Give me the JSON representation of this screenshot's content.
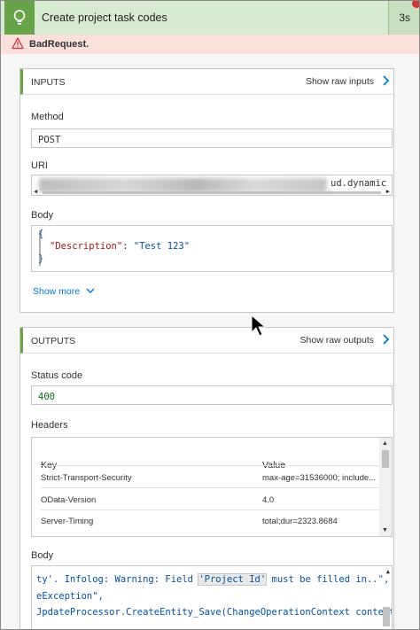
{
  "header": {
    "title": "Create project task codes",
    "duration": "3s"
  },
  "error": {
    "text": "BadRequest."
  },
  "inputs": {
    "title": "INPUTS",
    "raw_link": "Show raw inputs",
    "method_label": "Method",
    "method_value": "POST",
    "uri_label": "URI",
    "uri_value_visible": "ud.dynamic",
    "body_label": "Body",
    "body_lines": [
      "{",
      "\"Description\": \"Test 123\"",
      "}"
    ],
    "body_key": "\"Description\"",
    "body_val": "\"Test 123\"",
    "show_more": "Show more"
  },
  "outputs": {
    "title": "OUTPUTS",
    "raw_link": "Show raw outputs",
    "status_label": "Status code",
    "status_value": "400",
    "headers_label": "Headers",
    "headers_cols": [
      "Key",
      "Value"
    ],
    "headers_rows": [
      {
        "key": "Strict-Transport-Security",
        "value": "max-age=31536000; include..."
      },
      {
        "key": "OData-Version",
        "value": "4.0"
      },
      {
        "key": "Server-Timing",
        "value": "total;dur=2323.8684"
      }
    ],
    "body_label": "Body",
    "body_line1_a": "ty'. Infolog: Warning: Field ",
    "body_line1_b": "'Project Id'",
    "body_line1_c": " must be filled in..\",",
    "body_line2": "eException\",",
    "body_line3": "JpdateProcessor.CreateEntity_Save(ChangeOperationContext context, C"
  },
  "colors": {
    "accent": "#68a34a",
    "error_bg": "#fbe0dc",
    "link": "#0078d4"
  },
  "icons": [
    "lightbulb-icon",
    "warning-icon",
    "chevron-right-icon",
    "chevron-down-icon",
    "cursor-icon"
  ]
}
